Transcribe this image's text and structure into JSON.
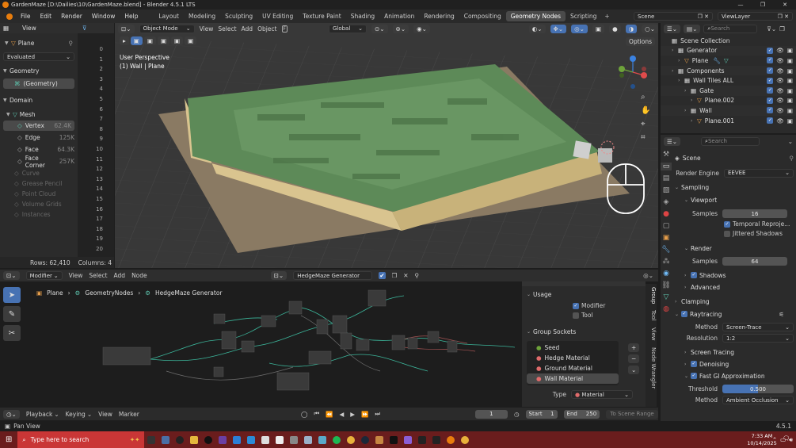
{
  "window": {
    "title": "GardenMaze [D:\\Dailies\\10\\GardenMaze.blend] - Blender 4.5.1 LTS"
  },
  "menus": [
    "File",
    "Edit",
    "Render",
    "Window",
    "Help"
  ],
  "workspaces": [
    "Layout",
    "Modeling",
    "Sculpting",
    "UV Editing",
    "Texture Paint",
    "Shading",
    "Animation",
    "Rendering",
    "Compositing",
    "Geometry Nodes",
    "Scripting"
  ],
  "active_workspace": "Geometry Nodes",
  "scene_selector": "Scene",
  "view_layer": "ViewLayer",
  "spreadsheet": {
    "view_label": "View",
    "object": "Plane",
    "evaluated": "Evaluated",
    "geometry_header": "Geometry",
    "geometry_item": "(Geometry)",
    "domain_header": "Domain",
    "mesh_label": "Mesh",
    "domains": [
      {
        "name": "Vertex",
        "count": "62.4K"
      },
      {
        "name": "Edge",
        "count": "125K"
      },
      {
        "name": "Face",
        "count": "64.3K"
      },
      {
        "name": "Face Corner",
        "count": "257K"
      }
    ],
    "other_domains": [
      "Curve",
      "Grease Pencil",
      "Point Cloud",
      "Volume Grids",
      "Instances"
    ],
    "row_numbers": [
      "0",
      "1",
      "2",
      "3",
      "4",
      "5",
      "6",
      "7",
      "8",
      "9",
      "10",
      "11",
      "12",
      "13",
      "14",
      "15",
      "16",
      "17",
      "18",
      "19",
      "20"
    ],
    "rows_label": "Rows: 62,410",
    "columns_label": "Columns: 4"
  },
  "viewport": {
    "mode": "Object Mode",
    "menus": [
      "View",
      "Select",
      "Add",
      "Object"
    ],
    "orientation": "Global",
    "options": "Options",
    "perspective": "User Perspective",
    "context": "(1) Wall | Plane"
  },
  "outliner": {
    "search_placeholder": "Search",
    "items": [
      {
        "label": "Scene Collection"
      },
      {
        "label": "Generator"
      },
      {
        "label": "Plane"
      },
      {
        "label": "Components"
      },
      {
        "label": "Wall Tiles ALL"
      },
      {
        "label": "Gate"
      },
      {
        "label": "Plane.002"
      },
      {
        "label": "Wall"
      },
      {
        "label": "Plane.001"
      }
    ]
  },
  "properties": {
    "search_placeholder": "Search",
    "scene": "Scene",
    "render_engine_label": "Render Engine",
    "render_engine": "EEVEE",
    "sampling": "Sampling",
    "viewport": "Viewport",
    "samples_label": "Samples",
    "viewport_samples": "16",
    "temporal_reprojection": "Temporal Reproje...",
    "jittered_shadows": "Jittered Shadows",
    "render": "Render",
    "render_samples": "64",
    "shadows": "Shadows",
    "advanced": "Advanced",
    "clamping": "Clamping",
    "raytracing": "Raytracing",
    "method_label": "Method",
    "method": "Screen-Trace",
    "resolution_label": "Resolution",
    "resolution": "1:2",
    "screen_tracing": "Screen Tracing",
    "denoising": "Denoising",
    "fast_gi": "Fast GI Approximation",
    "threshold_label": "Threshold",
    "threshold": "0.500",
    "method2": "Ambient Occlusion"
  },
  "node_editor": {
    "type": "Modifier",
    "menus": [
      "View",
      "Select",
      "Add",
      "Node"
    ],
    "tree": "HedgeMaze Generator",
    "breadcrumb": [
      "Plane",
      "GeometryNodes",
      "HedgeMaze Generator"
    ],
    "usage": "Usage",
    "modifier": "Modifier",
    "tool": "Tool",
    "group_sockets": "Group Sockets",
    "sockets": [
      "Seed",
      "Hedge Material",
      "Ground Material",
      "Wall Material"
    ],
    "type_label": "Type",
    "type_value": "Material",
    "tabs": [
      "Group",
      "Tool",
      "View",
      "Node Wrangler"
    ]
  },
  "timeline": {
    "menus": [
      "Playback",
      "Keying",
      "View",
      "Marker"
    ],
    "frame": "1",
    "start_label": "Start",
    "start": "1",
    "end_label": "End",
    "end": "250",
    "to_scene": "To Scene Range"
  },
  "status": {
    "left": "Pan View",
    "version": "4.5.1"
  },
  "taskbar": {
    "search": "Type here to search",
    "time": "7:33 AM",
    "date": "10/14/2025"
  }
}
